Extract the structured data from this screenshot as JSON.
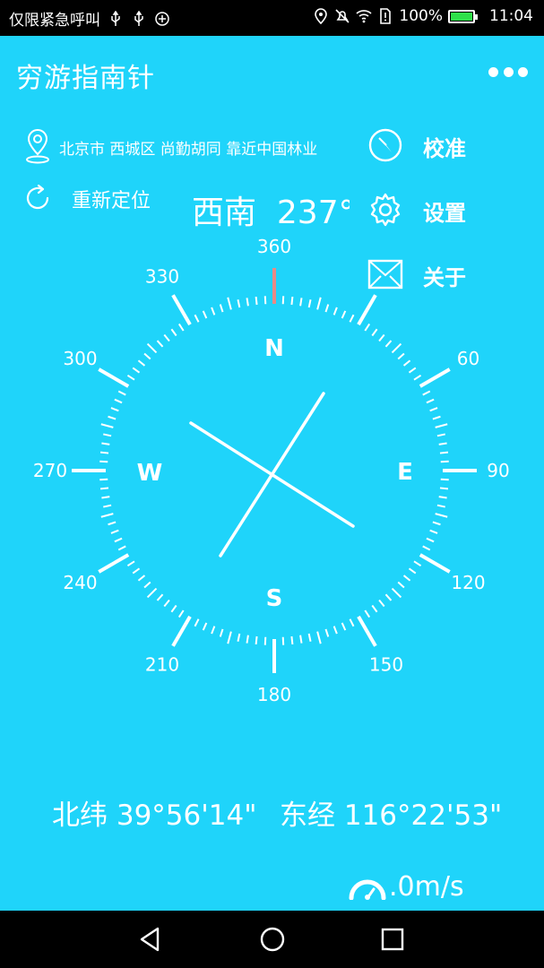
{
  "status_bar": {
    "left_text": "仅限紧急呼叫",
    "battery_percent": "100%",
    "time": "11:04",
    "icons": [
      "usb-icon",
      "usb-icon",
      "data-saver-icon",
      "location-icon",
      "mute-icon",
      "wifi-icon",
      "sim-icon",
      "battery-charging-icon"
    ]
  },
  "app": {
    "title": "穷游指南针"
  },
  "location": {
    "address": "北京市 西城区 尚勤胡同 靠近中国林业",
    "relocate_label": "重新定位"
  },
  "heading": {
    "direction": "西南",
    "degrees": "237°",
    "needle_angle": 237
  },
  "menu": {
    "calibrate": "校准",
    "settings": "设置",
    "about": "关于"
  },
  "compass": {
    "cardinals": {
      "n": "N",
      "e": "E",
      "s": "S",
      "w": "W"
    },
    "degree_labels": [
      "360",
      "60",
      "90",
      "120",
      "150",
      "180",
      "210",
      "240",
      "270",
      "300",
      "330"
    ]
  },
  "coordinates": {
    "latitude": "北纬 39°56'14\"",
    "longitude": "东经 116°22'53\""
  },
  "speed": {
    "value": ".0m/s"
  },
  "colors": {
    "background": "#1fd4fa",
    "north_marker": "#e98a86"
  }
}
